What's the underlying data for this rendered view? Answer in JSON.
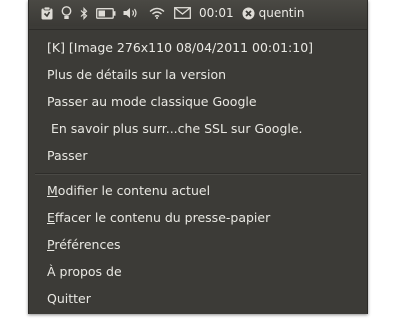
{
  "panel": {
    "clock": "00:01",
    "user": "quentin",
    "icons": [
      "clipboard-icon",
      "bulb-icon",
      "bluetooth-icon",
      "battery-icon",
      "volume-icon",
      "wifi-icon",
      "mail-icon",
      "session-icon"
    ]
  },
  "menu": {
    "history": [
      "[K] [Image 276x110 08/04/2011 00:01:10]",
      "Plus de détails sur la version",
      "Passer au mode classique Google",
      " En savoir plus surr...che SSL sur Google.",
      "Passer"
    ],
    "actions": {
      "modify": {
        "mnemonic": "M",
        "rest": "odifier le contenu actuel"
      },
      "clear": {
        "mnemonic": "E",
        "rest": "ffacer le contenu du presse-papier"
      },
      "prefs": {
        "mnemonic": "P",
        "rest": "références"
      },
      "about": "À propos de",
      "quit": "Quitter"
    }
  },
  "colors": {
    "menu_bg": "#3c3b37",
    "text": "#e9e8e3"
  }
}
